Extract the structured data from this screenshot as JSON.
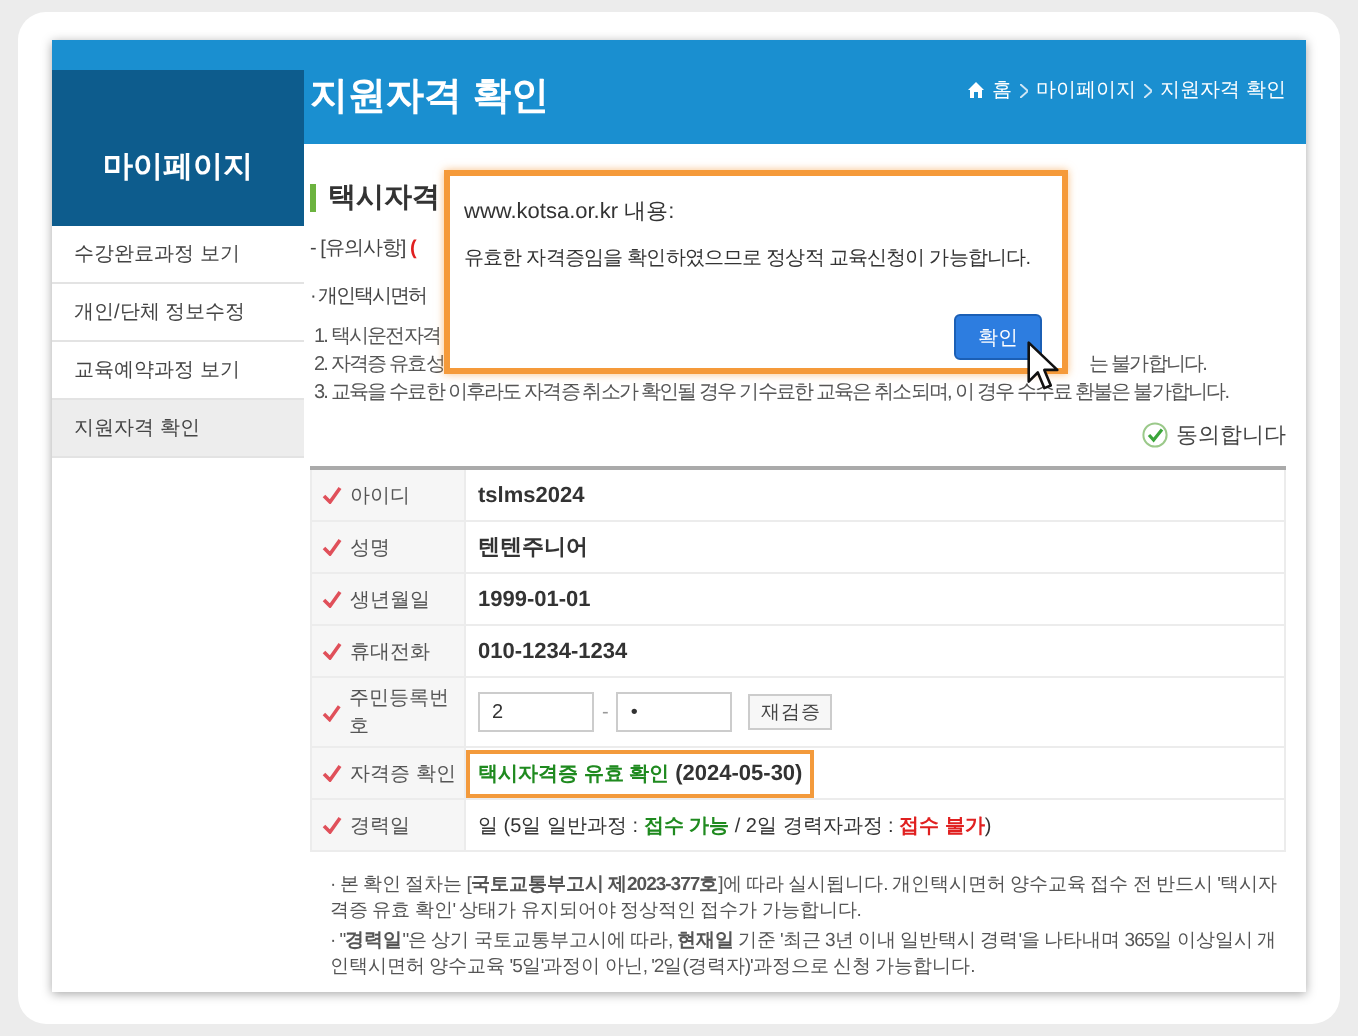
{
  "header": {
    "title": "지원자격 확인",
    "breadcrumb": [
      "홈",
      "마이페이지",
      "지원자격 확인"
    ]
  },
  "sidebar": {
    "title": "마이페이지",
    "items": [
      {
        "label": "수강완료과정 보기",
        "selected": false
      },
      {
        "label": "개인/단체 정보수정",
        "selected": false
      },
      {
        "label": "교육예약과정 보기",
        "selected": false
      },
      {
        "label": "지원자격 확인",
        "selected": true
      }
    ]
  },
  "section": {
    "heading": "택시자격",
    "notice": [
      {
        "text": "- [유의사항] ",
        "kind": "plain"
      },
      {
        "text": "(",
        "kind": "bad"
      }
    ],
    "subheading": "· 개인택시면허",
    "lines": [
      {
        "left": "1. 택시운전자격"
      },
      {
        "left": "2. 자격증 유효성",
        "right": "는 불가합니다."
      },
      {
        "left": "3. 교육을 수료한 이후라도 자격증 취소가 확인될 경우 기수료한 교육은 취소되며, 이 경우 수수료 환불은 불가합니다."
      }
    ],
    "agree": {
      "label": "동의합니다",
      "checked": true
    }
  },
  "table": {
    "rows": [
      {
        "label": "아이디",
        "kind": "text",
        "segments": [
          {
            "text": "tslms2024",
            "kind": "bold"
          }
        ]
      },
      {
        "label": "성명",
        "kind": "text",
        "segments": [
          {
            "text": "텐텐주니어",
            "kind": "bold"
          }
        ]
      },
      {
        "label": "생년월일",
        "kind": "text",
        "segments": [
          {
            "text": "1999-01-01",
            "kind": "bold"
          }
        ]
      },
      {
        "label": "휴대전화",
        "kind": "text",
        "segments": [
          {
            "text": "010-1234-1234",
            "kind": "bold"
          }
        ]
      },
      {
        "label": "주민등록번호",
        "kind": "id_number",
        "fields": [
          "2",
          "•"
        ],
        "separator": "-",
        "button": "재검증"
      },
      {
        "label": "자격증 확인",
        "kind": "text",
        "highlighted": true,
        "segments": [
          {
            "text": "택시자격증 유효 확인",
            "kind": "ok"
          },
          {
            "text": " (2024-05-30)",
            "kind": "bold"
          }
        ]
      },
      {
        "label": "경력일",
        "kind": "text",
        "segments": [
          {
            "text": "일  (5일 일반과정 : ",
            "kind": "plain"
          },
          {
            "text": "접수 가능",
            "kind": "ok"
          },
          {
            "text": "   / 2일 경력자과정 : ",
            "kind": "plain"
          },
          {
            "text": "접수 불가",
            "kind": "bad"
          },
          {
            "text": ")",
            "kind": "plain"
          }
        ]
      }
    ]
  },
  "notes": [
    "· 본 확인 절차는 [**국토교통부고시 제2023-377호**]에 따라 실시됩니다. 개인택시면허 양수교육 접수 전 반드시 '택시자격증 유효 확인' 상태가 유지되어야 정상적인 접수가 가능합니다.",
    "· \"**경력일**\"은 상기 국토교통부고시에 따라, **현재일** 기준 '최근 3년 이내 일반택시 경력'을 나타내며 365일 이상일시 개인택시면허 양수교육 '5일'과정이 아닌, '2일(경력자)'과정으로 신청 가능합니다."
  ],
  "dialog": {
    "title": "www.kotsa.or.kr 내용:",
    "message": "유효한 자격증임을 확인하였으므로 정상적 교육신청이 가능합니다.",
    "button": "확인"
  }
}
